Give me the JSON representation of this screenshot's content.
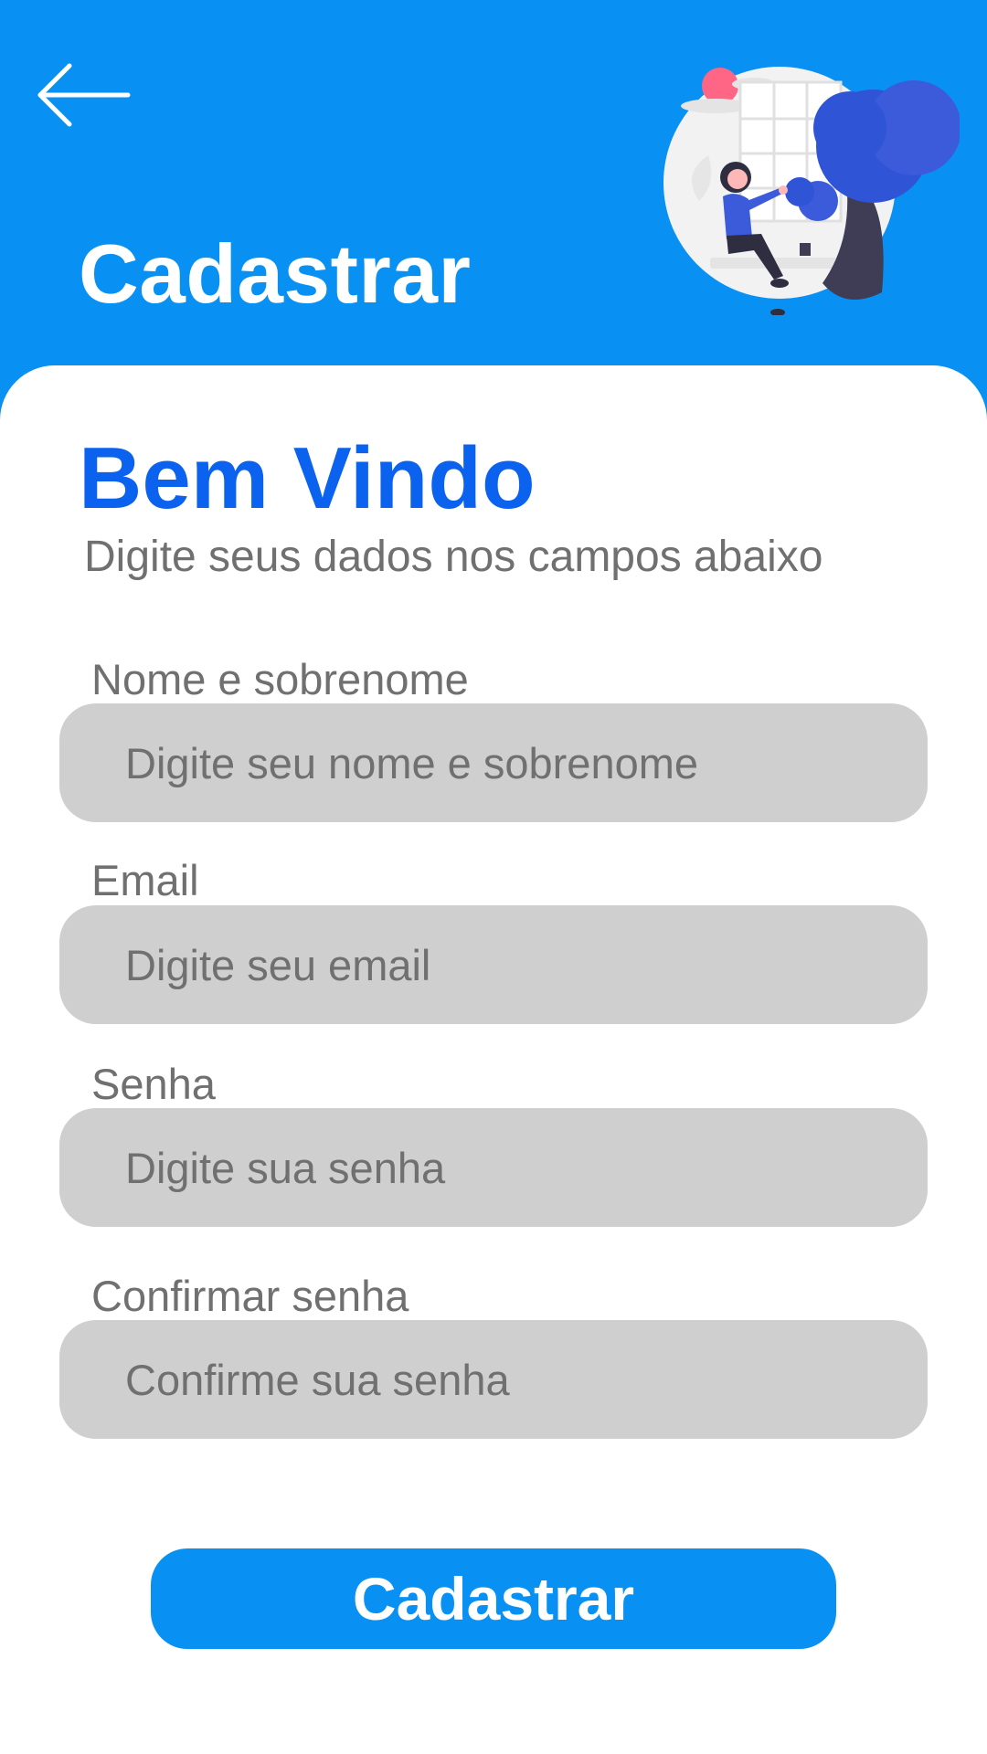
{
  "header": {
    "title": "Cadastrar",
    "back_icon": "arrow-left-icon",
    "illustration": "person-sitting-by-window-illustration",
    "background_color": "#0891F3"
  },
  "welcome": {
    "title": "Bem Vindo",
    "subtitle": "Digite seus dados nos campos abaixo",
    "title_color": "#0B62EE"
  },
  "form": {
    "fields": [
      {
        "label": "Nome e sobrenome",
        "placeholder": "Digite seu nome e sobrenome",
        "value": ""
      },
      {
        "label": "Email",
        "placeholder": "Digite seu email",
        "value": ""
      },
      {
        "label": "Senha",
        "placeholder": "Digite sua senha",
        "value": ""
      },
      {
        "label": "Confirmar senha",
        "placeholder": "Confirme sua senha",
        "value": ""
      }
    ],
    "input_background": "#CFCFCF",
    "submit_label": "Cadastrar"
  }
}
